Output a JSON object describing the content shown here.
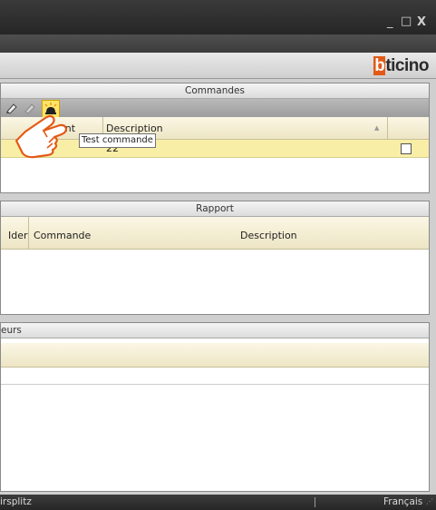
{
  "window": {
    "controls": [
      "_",
      "□",
      "X"
    ]
  },
  "brand": {
    "logo_prefix": "b",
    "logo_rest": "ticino",
    "color": "#e35a16"
  },
  "commands_panel": {
    "title": "Commandes",
    "tool_icons": [
      "edit-icon",
      "edit-disabled-icon",
      "test-lamp-icon"
    ],
    "columns": [
      "ant",
      "Description"
    ],
    "rows": [
      {
        "description": "22°",
        "checked": false
      }
    ],
    "tooltip": "Test commande"
  },
  "report_panel": {
    "title": "Rapport",
    "columns": [
      "Ider",
      "Commande",
      "Description"
    ]
  },
  "lower_panel": {
    "title": "eurs"
  },
  "statusbar": {
    "left": "irsplitz",
    "right": "Français"
  }
}
